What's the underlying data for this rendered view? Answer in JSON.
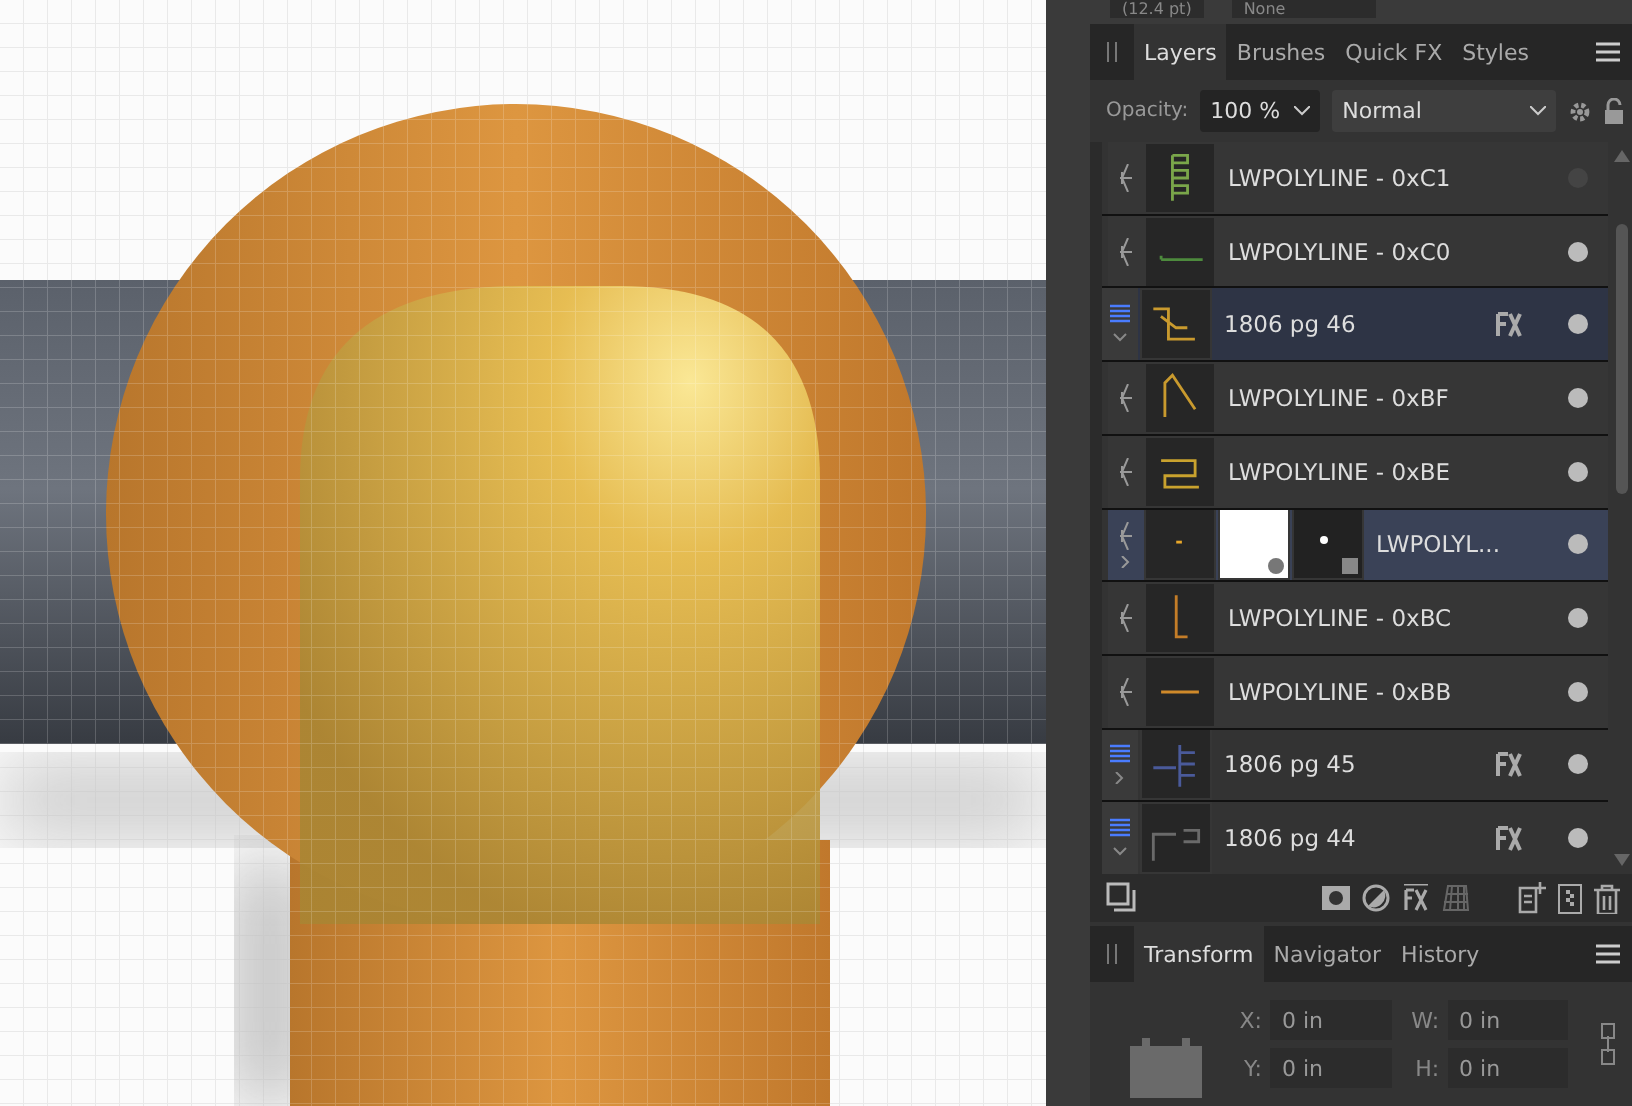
{
  "toolbar": {
    "font_size": "(12.4 pt)",
    "style": "None"
  },
  "layers_panel": {
    "tabs": [
      {
        "label": "Layers",
        "selected": true
      },
      {
        "label": "Brushes",
        "selected": false
      },
      {
        "label": "Quick FX",
        "selected": false
      },
      {
        "label": "Styles",
        "selected": false
      }
    ],
    "opacity_label": "Opacity:",
    "opacity": "100 %",
    "blend_mode": "Normal",
    "layers": [
      {
        "kind": "child",
        "name": "LWPOLYLINE - 0xC1",
        "selected": false,
        "visible": false,
        "fx": false
      },
      {
        "kind": "child",
        "name": "LWPOLYLINE - 0xC0",
        "selected": false,
        "visible": true,
        "fx": false
      },
      {
        "kind": "group",
        "name": "1806 pg 46",
        "selected": true,
        "visible": true,
        "fx": true,
        "expanded": true
      },
      {
        "kind": "child",
        "name": "LWPOLYLINE - 0xBF",
        "selected": false,
        "visible": true,
        "fx": false
      },
      {
        "kind": "child",
        "name": "LWPOLYLINE - 0xBE",
        "selected": false,
        "visible": true,
        "fx": false
      },
      {
        "kind": "masked",
        "name": "LWPOLYL...",
        "selected": true,
        "visible": true,
        "fx": false,
        "expanded": false
      },
      {
        "kind": "child",
        "name": "LWPOLYLINE - 0xBC",
        "selected": false,
        "visible": true,
        "fx": false
      },
      {
        "kind": "child",
        "name": "LWPOLYLINE - 0xBB",
        "selected": false,
        "visible": true,
        "fx": false
      },
      {
        "kind": "group",
        "name": "1806 pg 45",
        "selected": false,
        "visible": true,
        "fx": true,
        "expanded": false
      },
      {
        "kind": "group",
        "name": "1806 pg 44",
        "selected": false,
        "visible": true,
        "fx": true,
        "expanded": true
      }
    ]
  },
  "transform_panel": {
    "tabs": [
      {
        "label": "Transform",
        "selected": true
      },
      {
        "label": "Navigator",
        "selected": false
      },
      {
        "label": "History",
        "selected": false
      }
    ],
    "fields": [
      {
        "label": "X:",
        "value": "0 in"
      },
      {
        "label": "W:",
        "value": "0 in"
      },
      {
        "label": "Y:",
        "value": "0 in"
      },
      {
        "label": "H:",
        "value": "0 in"
      }
    ]
  }
}
